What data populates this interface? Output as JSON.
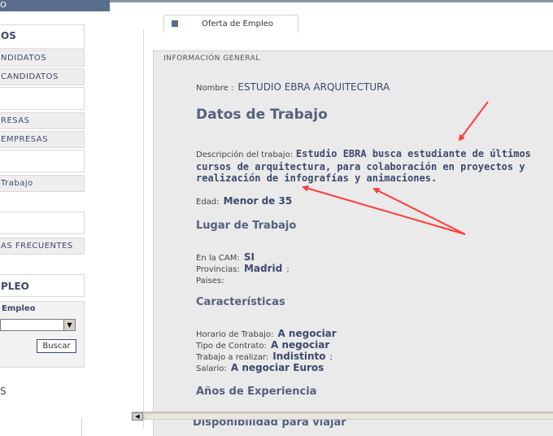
{
  "topbar": {
    "text": "O"
  },
  "sidebar": {
    "heading_1": "OS",
    "items_1": [
      "NDIDATOS",
      "CANDIDATOS"
    ],
    "items_2": [
      "RESAS",
      "EMPRESAS"
    ],
    "item_3": "Trabajo",
    "item_4": "AS FRECUENTES",
    "heading_empleo": "PLEO",
    "form_label": "Empleo",
    "select_value": "",
    "search_button": "Buscar",
    "tail": "S"
  },
  "tab": {
    "label": "Oferta de Empleo"
  },
  "content": {
    "section_label": "INFORMACIÓN GENERAL",
    "nombre_label": "Nombre :",
    "nombre_value": "ESTUDIO EBRA ARQUITECTURA",
    "datos_heading": "Datos de Trabajo",
    "descripcion_label": "Descripción del trabajo:",
    "descripcion_value": "Estudio EBRA busca estudiante de últimos cursos de arquitectura, para colaboración en proyectos y realización de infografías y animaciones.",
    "edad_label": "Edad:",
    "edad_value": "Menor de 35",
    "lugar_heading": "Lugar de Trabajo",
    "cam_label": "En la CAM:",
    "cam_value": "SI",
    "provincias_label": "Provincias:",
    "provincias_value": "Madrid",
    "provincias_suffix": ";",
    "paises_label": "Paises:",
    "caracteristicas_heading": "Características",
    "horario_label": "Horario de Trabajo:",
    "horario_value": "A negociar",
    "contrato_label": "Tipo de Contrato:",
    "contrato_value": "A negociar",
    "realizar_label": "Trabajo a realizar:",
    "realizar_value": "Indistinto",
    "realizar_suffix": ";",
    "salario_label": "Salario:",
    "salario_value": "A negociar Euros",
    "experiencia_heading": "Años de Experiencia",
    "disponibilidad_heading": "Disponibilidad para viajar"
  },
  "colors": {
    "accent": "#3c4a6e",
    "heading": "#55617e",
    "arrow": "#ff3b3b",
    "panel_bg": "#eaeaea"
  },
  "icons": {
    "scroll_left": "arrow-left-icon",
    "select_dropdown": "chevron-down-icon",
    "tab_marker": "square-icon"
  }
}
